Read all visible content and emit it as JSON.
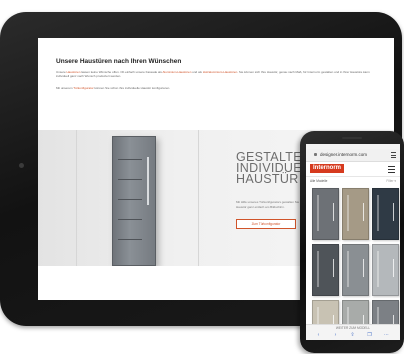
{
  "tablet": {
    "heading": "Unsere Haustüren nach Ihren Wünschen",
    "paragraph1": {
      "before": "Unsere ",
      "link1": "Haustüren",
      "middle": " lassen keine Wünsche offen. Ob einfach unsere Fassade als ",
      "link2": "Aluminium-Haustüren",
      "middle2": " und als ",
      "link3": "Holzaluminium-Haustüren",
      "after": ". Sie können sich Ihre Haustür, genau nach Maß, für Internorm gestalten und in Ihrer Haustüre kann individuell ganz nach Wunsch produziert werden."
    },
    "paragraph2": {
      "before": "Mit unserem ",
      "link": "Türkonfigurator",
      "after": " können Sie schon ihre individuelle Haustür konfigurieren."
    },
    "banner": {
      "headline_line1": "GESTALTEN",
      "headline_line2": "INDIVIDUELL",
      "headline_line3": "HAUSTÜR",
      "subtext": "Mit Hilfe unseres Türkonfigurators gestalten Sie Ihre Haustür ganz einfach am Bildschirm.",
      "cta_label": "Zum Türkonfigurator"
    }
  },
  "phone": {
    "url": "designer.internorm.com",
    "logo": "Internorm",
    "filter_label": "Alle Modelle",
    "filter_right": "Filter  ▾",
    "bottom_text": "WEITER ZUM MODELL",
    "door_colors": [
      "#6d7176",
      "#a59a86",
      "#2f3a45",
      "#4f5459",
      "#8a8f93",
      "#b4b8bb",
      "#c8c2b3",
      "#a8aba9",
      "#7c8085"
    ],
    "nav_icons": [
      "‹",
      "›",
      "⇪",
      "❐",
      "⋯"
    ]
  }
}
